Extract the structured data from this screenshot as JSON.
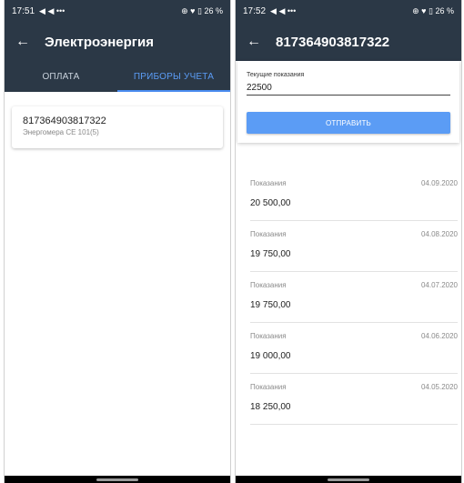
{
  "left_screen": {
    "status_bar": {
      "time": "17:51",
      "left_icons": "◀ ◀ •••",
      "right_icons": "⊕ ♥ ▯ 26 %"
    },
    "app_bar": {
      "title": "Электроэнергия"
    },
    "tabs": [
      {
        "label": "ОПЛАТА",
        "active": false
      },
      {
        "label": "ПРИБОРЫ УЧЕТА",
        "active": true
      }
    ],
    "meter_card": {
      "number": "817364903817322",
      "model": "Энергомера CE 101(5)"
    }
  },
  "right_screen": {
    "status_bar": {
      "time": "17:52",
      "left_icons": "◀ ◀ •••",
      "right_icons": "⊕ ♥ ▯ 26 %"
    },
    "app_bar": {
      "title": "817364903817322"
    },
    "input": {
      "label": "Текущие показания",
      "value": "22500"
    },
    "submit_label": "ОТПРАВИТЬ",
    "history": [
      {
        "caption": "Показания",
        "date": "04.09.2020",
        "value": "20 500,00"
      },
      {
        "caption": "Показания",
        "date": "04.08.2020",
        "value": "19 750,00"
      },
      {
        "caption": "Показания",
        "date": "04.07.2020",
        "value": "19 750,00"
      },
      {
        "caption": "Показания",
        "date": "04.06.2020",
        "value": "19 000,00"
      },
      {
        "caption": "Показания",
        "date": "04.05.2020",
        "value": "18 250,00"
      }
    ]
  },
  "colors": {
    "app_bar": "#2b3846",
    "accent": "#5b9cf5",
    "divider": "#e2e2e2"
  }
}
